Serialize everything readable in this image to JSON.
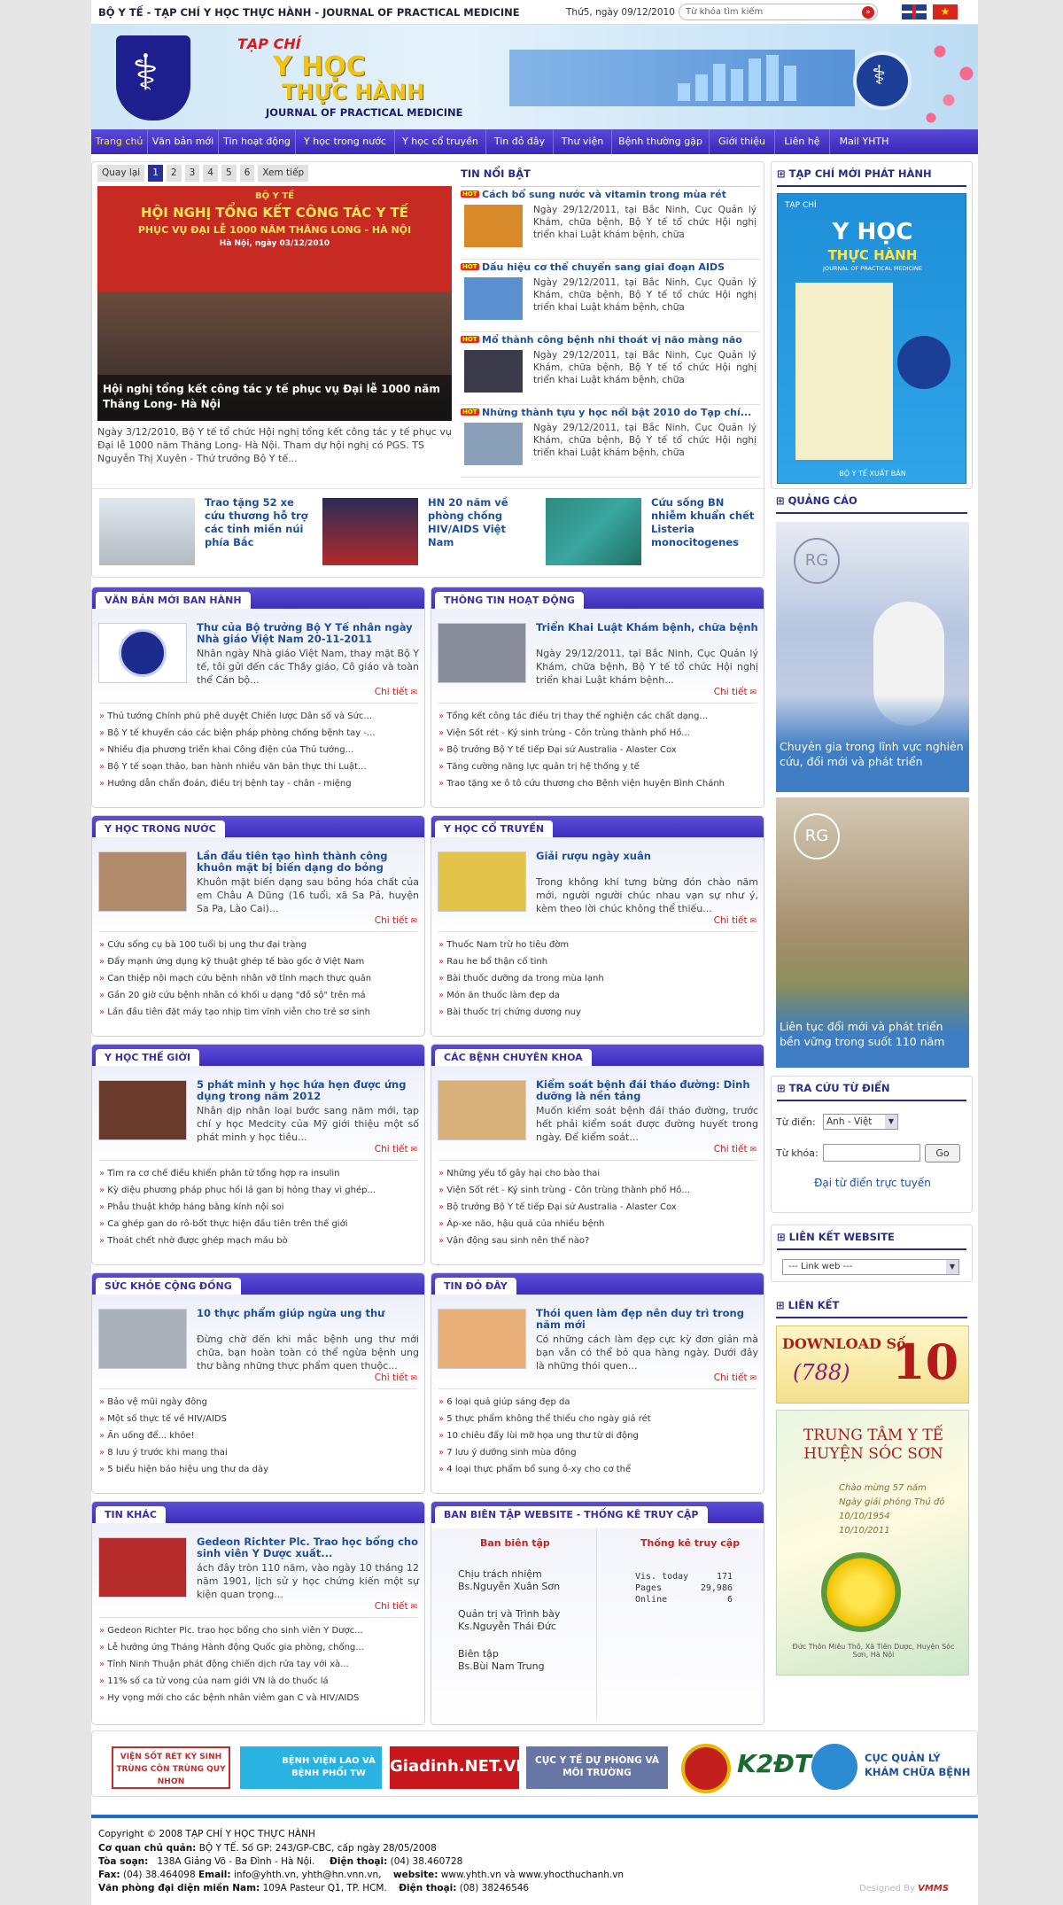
{
  "topbar": {
    "org": "BỘ Y TẾ - TẠP CHÍ Y HỌC THỰC HÀNH - JOURNAL OF PRACTICAL MEDICINE",
    "date": "Thứ5, ngày 09/12/2010",
    "search_placeholder": "Từ khóa tìm kiếm"
  },
  "banner": {
    "tapchi": "TẠP CHÍ",
    "title1": "Y HỌC",
    "title2": "THỰC HÀNH",
    "subtitle": "JOURNAL OF PRACTICAL MEDICINE"
  },
  "nav": [
    "Trang chủ",
    "Văn bản mới",
    "Tin hoạt động",
    "Y học trong nước",
    "Y học cổ truyền",
    "Tin đỏ đây",
    "Thư viện",
    "Bệnh thường gặp",
    "Giới thiệu",
    "Liên hệ",
    "Mail YHTH"
  ],
  "slider": {
    "pager": [
      "Quay lại",
      "1",
      "2",
      "3",
      "4",
      "5",
      "6",
      "Xem tiếp"
    ],
    "banner_lines": [
      "BỘ Y TẾ",
      "HỘI NGHỊ TỔNG KẾT CÔNG TÁC Y TẾ",
      "PHỤC VỤ ĐẠI LỄ 1000 NĂM THĂNG LONG - HÀ NỘI",
      "Hà Nội, ngày 03/12/2010"
    ],
    "caption": "Hội nghị tổng kết công tác y tế phục vụ Đại lễ 1000 năm Thăng Long- Hà Nội",
    "desc": "Ngày 3/12/2010, Bộ Y tế tổ chức Hội nghị tổng kết công tác y tế phục vụ Đại lễ 1000 năm Thăng Long- Hà Nội. Tham dự hội nghị có PGS. TS Nguyễn Thị Xuyên - Thứ trưởng Bộ Y tế..."
  },
  "hot": {
    "title": "TIN NỔI BẬT",
    "badge": "HOT",
    "items": [
      {
        "title": "Cách bổ sung nước và vitamin trong mùa rét",
        "desc": "Ngày 29/12/2011, tại Bắc Ninh, Cục Quản lý Khám, chữa bệnh, Bộ Y tế tổ chức Hội nghị triển khai Luật khám bệnh, chữa"
      },
      {
        "title": "Dấu hiệu cơ thể chuyển sang giai đoạn AIDS",
        "desc": "Ngày 29/12/2011, tại Bắc Ninh, Cục Quản lý Khám, chữa bệnh, Bộ Y tế tổ chức Hội nghị triển khai Luật khám bệnh, chữa"
      },
      {
        "title": "Mổ thành công  bệnh nhi thoát vị não màng não",
        "desc": "Ngày 29/12/2011, tại Bắc Ninh, Cục Quản lý Khám, chữa bệnh, Bộ Y tế tổ chức Hội nghị triển khai Luật khám bệnh, chữa"
      },
      {
        "title": "Những thành tựu y học nổi bật 2010 do Tạp chí...",
        "desc": "Ngày 29/12/2011, tại Bắc Ninh, Cục Quản lý Khám, chữa bệnh, Bộ Y tế tổ chức Hội nghị triển khai Luật khám bệnh, chữa"
      }
    ]
  },
  "strip": [
    {
      "title": "Trao tặng 52 xe cứu thương hỗ trợ các tỉnh miền núi phía Bắc"
    },
    {
      "title": "HN 20 năm về phòng chống HIV/AIDS Việt Nam"
    },
    {
      "title": "Cứu sống BN nhiễm khuẩn chết Listeria monocitogenes"
    }
  ],
  "detail_label": "Chi tiết",
  "sections": [
    {
      "title": "VĂN BẢN MỚI BAN HÀNH",
      "feat": "Thư của Bộ trưởng Bộ Y Tế nhân ngày Nhà giáo Việt Nam 20-11-2011",
      "desc": "Nhân ngày Nhà giáo Việt Nam, thay mặt Bộ Y tế, tôi gửi đến các Thầy giáo, Cô giáo và toàn thể Cán bộ...",
      "items": [
        "Thủ tướng Chính phủ phê duyệt Chiến lược Dân số và Sức...",
        "Bộ Y tế khuyến cáo các biện pháp phòng chống bệnh tay -...",
        "Nhiều địa phương triển khai Công điện của Thủ tướng...",
        "Bộ Y tế soạn thảo, ban hành nhiều văn bản thực thi Luật...",
        "Hướng dẫn chẩn đoán, điều trị bệnh tay - chân - miệng"
      ]
    },
    {
      "title": "THÔNG TIN HOẠT ĐỘNG",
      "feat": "Triển Khai Luật Khám bệnh, chữa bệnh",
      "desc": "Ngày 29/12/2011, tại Bắc Ninh, Cục Quản lý Khám, chữa bệnh, Bộ Y tế tổ chức Hội nghị triển khai Luật khám bệnh...",
      "items": [
        "Tổng kết công tác điều trị thay thế nghiện các chất dạng...",
        "Viện Sốt rét - Ký sinh trùng - Côn trùng thành phố Hồ...",
        "Bộ trưởng Bộ Y tế tiếp Đại sứ Australia - Alaster Cox",
        "Tăng cường năng lực quản trị hệ thống y tế",
        "Trao tặng xe ô tô cứu thương cho Bệnh viện huyện Bình Chánh"
      ]
    },
    {
      "title": "Y HỌC TRONG NƯỚC",
      "feat": "Lần đầu tiên tạo hình thành công khuôn mặt bị biến dạng do bỏng",
      "desc": "Khuôn mặt biến dạng sau bỏng hóa chất của em Châu A Dũng (16 tuổi, xã Sa Pả, huyện Sa Pa, Lào Cai)...",
      "items": [
        "Cứu sống cụ bà 100 tuổi bị ung thư đại tràng",
        "Đẩy mạnh ứng dụng kỹ thuật ghép tế bào gốc ở Việt Nam",
        "Can thiệp nội mạch cứu bệnh nhân vỡ tĩnh mạch thực quản",
        "Gần 20 giờ cứu bệnh nhân có khối u dạng \"đồ sộ\" trên má",
        "Lần đầu tiên đặt máy tạo nhịp tim vĩnh viễn cho trẻ sơ sinh"
      ]
    },
    {
      "title": "Y HỌC CỔ TRUYỀN",
      "feat": "Giải rượu ngày xuân",
      "desc": "Trong không khí tưng bừng đón chào năm mới, người người chúc nhau vạn sự như ý, kèm theo lời chúc không thể thiếu...",
      "items": [
        "Thuốc Nam trừ ho tiêu đờm",
        "Rau he bổ thận cố tinh",
        "Bài thuốc dưỡng da trong mùa lạnh",
        "Món ăn thuốc làm đẹp da",
        "Bài thuốc trị chứng dương nuy"
      ]
    },
    {
      "title": "Y HỌC THẾ GIỚI",
      "feat": "5 phát minh y học hứa hẹn được ứng dụng trong năm 2012",
      "desc": "Nhân dịp nhân loại bước sang năm mới, tạp chí y học Medcity của Mỹ giới thiệu một số phát minh y học tiêu...",
      "items": [
        "Tìm ra cơ chế điều khiển phân tử tổng hợp ra insulin",
        "Kỳ diệu phương pháp phục hồi lá gan bị hỏng thay vì ghép...",
        "Phẫu thuật khớp háng bằng kính nội soi",
        "Ca ghép gan do rô-bốt thực hiện đầu tiên trên thế giới",
        "Thoát chết nhờ được ghép mạch máu bò"
      ]
    },
    {
      "title": "CÁC BỆNH CHUYÊN KHOA",
      "feat": "Kiểm soát bệnh đái tháo đường: Dinh dưỡng là nền tảng",
      "desc": "Muốn kiểm soát bệnh đái tháo đường, trước hết phải kiểm soát được đường huyết trong ngày. Để kiểm soát...",
      "items": [
        "Những yếu tố gây hại cho bào thai",
        "Viện Sốt rét - Ký sinh trùng - Côn trùng thành phố Hồ...",
        "Bộ trưởng Bộ Y tế tiếp Đại sứ Australia - Alaster Cox",
        "Áp-xe não, hậu quả của nhiều bệnh",
        "Vận động sau sinh nên thế nào?"
      ]
    },
    {
      "title": "SỨC KHỎE CỘNG ĐỒNG",
      "feat": "10 thực phẩm giúp ngừa ung thư",
      "desc": "Đừng chờ đến khi mắc bệnh ung thư mới chữa, bạn hoàn toàn có thể ngừa bệnh ung thư bằng những thực phẩm quen thuộc...",
      "items": [
        "Bảo vệ mũi ngày đông",
        "Một số thực tế về HIV/AIDS",
        "Ăn uống để... khỏe!",
        "8 lưu ý trước khi mang thai",
        "5 biểu hiện báo hiệu ung thư da dày"
      ]
    },
    {
      "title": "TIN ĐỎ ĐÂY",
      "feat": "Thói quen làm đẹp nên duy trì trong năm mới",
      "desc": "Có những cách làm đẹp cực kỳ đơn giản mà bạn vẫn có thể bỏ qua hàng ngày. Dưới đây là những thói quen...",
      "items": [
        "6 loại quả giúp sáng đẹp da",
        "5 thực phẩm không thể thiếu cho ngày giá rét",
        "10 chiêu đẩy lùi mỡ họa ung thư từ di động",
        "7 lưu ý dưỡng sinh mùa đông",
        "4 loại thực phẩm bổ sung ô-xy cho cơ thể"
      ]
    },
    {
      "title": "TIN KHÁC",
      "feat": "Gedeon Richter Plc. Trao học bổng cho sinh viên Y Dược xuất...",
      "desc": "ách đây tròn 110 năm, vào ngày 10 tháng 12 năm 1901, lịch sử y học chứng kiến một sự kiện quan trọng...",
      "items": [
        "Gedeon Richter Plc. trao học bổng cho sinh viên Y Dược...",
        "Lễ hưởng ứng Tháng Hành động Quốc gia phòng, chống...",
        "Tỉnh Ninh Thuận phát động chiến dịch rửa tay với xà...",
        "11% số ca tử vong của nam giới VN là do thuốc lá",
        "Hy vọng mới cho các bệnh nhân viêm gan C và HIV/AIDS"
      ]
    }
  ],
  "stats": {
    "title": "BAN BIÊN TẬP WEBSITE - THỐNG KÊ TRUY CẬP",
    "col1": "Ban biên tập",
    "col2": "Thống kê truy cập",
    "roles": [
      {
        "role": "Chịu trách nhiệm",
        "name": "Bs.Nguyễn Xuân Sơn"
      },
      {
        "role": "Quản trị và Trình bày",
        "name": "Ks.Nguyễn Thái Đức"
      },
      {
        "role": "Biên tập",
        "name": "Bs.Bùi Nam Trung"
      }
    ],
    "visits": [
      {
        "label": "Vis. today",
        "value": "171"
      },
      {
        "label": "Pages",
        "value": "29,986"
      },
      {
        "label": "Online",
        "value": "6"
      }
    ]
  },
  "sidebar": {
    "latest_title": "TẠP CHÍ MỚI PHÁT HÀNH",
    "cover_tapchi": "TẠP CHÍ",
    "cover_t1": "Y HỌC",
    "cover_t2": "THỰC HÀNH",
    "cover_sub": "JOURNAL OF PRACTICAL MEDICINE",
    "cover_pub": "BỘ Y TẾ XUẤT BẢN",
    "ads_title": "QUẢNG CÁO",
    "ad1": "Chuyên gia trong lĩnh vực nghiên cứu, đổi mới và phát triển",
    "ad2": "Liên tục đổi mới và phát triển bền vững trong suốt 110 năm",
    "ad_brand": "RG",
    "dict_title": "TRA CỨU TỪ ĐIỂN",
    "dict_label": "Từ điển:",
    "dict_value": "Anh - Việt",
    "keyword_label": "Từ khóa:",
    "go": "Go",
    "dict_link": "Đại từ điển trực tuyến",
    "links_title": "LIÊN KẾT WEBSITE",
    "links_value": "--- Link web ---",
    "link_title": "LIÊN KẾT",
    "download_label": "DOWNLOAD Số",
    "download_issue": "(788)",
    "download_num": "10",
    "center_title": "TRUNG TÂM Y TẾ HUYỆN SÓC SƠN",
    "center_lines": [
      "Chào mừng 57 năm",
      "Ngày giải phóng Thủ đô",
      "10/10/1954",
      "10/10/2011"
    ],
    "center_addr": "Đức Thôn Miêu Thô, Xã Tiên Dược, Huyện Sóc Sơn, Hà Nội"
  },
  "partners": [
    {
      "label": "VIỆN SỐT RÉT KÝ SINH TRÙNG CÔN TRÙNG QUY NHƠN"
    },
    {
      "label": "BỆNH VIỆN LAO VÀ BỆNH PHỔI TW"
    },
    {
      "label": "Giadinh.NET.VN"
    },
    {
      "label": "CỤC Y TẾ DỰ PHÒNG VÀ MÔI TRƯỜNG"
    },
    {
      "label": "K2ĐT"
    },
    {
      "label": "CỤC QUẢN LÝ KHÁM CHỮA BỆNH"
    }
  ],
  "footer": {
    "copyright": "Copyright © 2008 TẠP CHÍ Y HỌC THỰC HÀNH",
    "l2a": "Cơ quan chủ quản:",
    "l2b": "BỘ Y TẾ. Số GP: 243/GP-CBC, cấp ngày 28/05/2008",
    "l3a": "Tòa soạn:",
    "l3b": "138A Giảng Võ - Ba Đình - Hà Nội.",
    "l3c": "Điện thoại:",
    "l3d": "(04) 38.460728",
    "l4a": "Fax:",
    "l4b": "(04) 38.464098",
    "l4c": "Email:",
    "l4d": "info@yhth.vn, yhth@hn.vnn.vn,",
    "l4e": "website:",
    "l4f": "www.yhth.vn và www.yhocthuchanh.vn",
    "l5a": "Văn phòng đại diện miền Nam:",
    "l5b": "109A Pasteur Q1, TP. HCM.",
    "l5c": "Điện thoại:",
    "l5d": "(08) 38246546",
    "designed": "Designed By",
    "designer": "VMMS"
  }
}
